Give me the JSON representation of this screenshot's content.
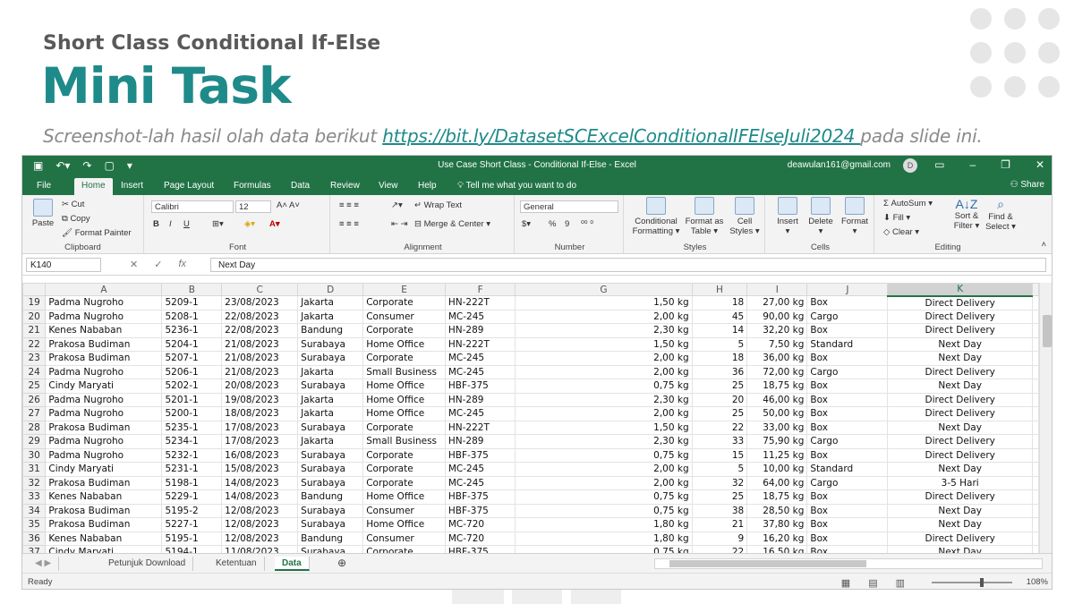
{
  "slide": {
    "kicker": "Short Class Conditional If-Else",
    "title": "Mini Task",
    "subtitle_pre": "Screenshot-lah hasil olah data berikut ",
    "subtitle_link": "https://bit.ly/DatasetSCExcelConditionalIFElseJuli2024 ",
    "subtitle_post": "pada slide ini."
  },
  "window": {
    "title": "Use Case Short Class - Conditional If-Else  -  Excel",
    "user_email": "deawulan161@gmail.com",
    "avatar_initial": "D",
    "icons": [
      "save-icon",
      "undo-icon",
      "redo-icon",
      "new-file-icon",
      "minimize-icon",
      "maximize-icon",
      "close-icon"
    ]
  },
  "ribbon_tabs": [
    "File",
    "Home",
    "Insert",
    "Page Layout",
    "Formulas",
    "Data",
    "Review",
    "View",
    "Help"
  ],
  "active_tab": "Home",
  "tell_me": "Tell me what you want to do",
  "share": "Share",
  "ribbon": {
    "clipboard": {
      "paste": "Paste",
      "cut": "Cut",
      "copy": "Copy",
      "format_painter": "Format Painter",
      "label": "Clipboard"
    },
    "font": {
      "family": "Calibri",
      "size": "12",
      "bold": "B",
      "italic": "I",
      "underline": "U",
      "label": "Font"
    },
    "alignment": {
      "wrap": "Wrap Text",
      "merge": "Merge & Center",
      "label": "Alignment"
    },
    "number": {
      "format": "General",
      "percent": "%",
      "comma": "9",
      "label": "Number"
    },
    "styles": {
      "conditional": "Conditional",
      "conditional2": "Formatting",
      "format_as": "Format as",
      "format_as2": "Table",
      "cell": "Cell",
      "cell2": "Styles",
      "label": "Styles"
    },
    "cells": {
      "insert": "Insert",
      "delete": "Delete",
      "format": "Format",
      "label": "Cells"
    },
    "editing": {
      "autosum": "AutoSum",
      "fill": "Fill",
      "clear": "Clear",
      "sort": "Sort &",
      "sort2": "Filter",
      "find": "Find &",
      "find2": "Select",
      "label": "Editing"
    }
  },
  "formula_bar": {
    "name_box": "K140",
    "fx": "fx",
    "value": "Next Day"
  },
  "columns": [
    "A",
    "B",
    "C",
    "D",
    "E",
    "F",
    "G",
    "H",
    "I",
    "J",
    "K"
  ],
  "selected_column": "K",
  "rows": [
    {
      "n": "19",
      "a": "Padma Nugroho",
      "b": "5209-1",
      "c": "23/08/2023",
      "d": "Jakarta",
      "e": "Corporate",
      "f": "HN-222T",
      "g": "1,50 kg",
      "h": "18",
      "i": "27,00 kg",
      "j": "Box",
      "k": "Direct Delivery"
    },
    {
      "n": "20",
      "a": "Padma Nugroho",
      "b": "5208-1",
      "c": "22/08/2023",
      "d": "Jakarta",
      "e": "Consumer",
      "f": "MC-245",
      "g": "2,00 kg",
      "h": "45",
      "i": "90,00 kg",
      "j": "Cargo",
      "k": "Direct Delivery"
    },
    {
      "n": "21",
      "a": "Kenes Nababan",
      "b": "5236-1",
      "c": "22/08/2023",
      "d": "Bandung",
      "e": "Corporate",
      "f": "HN-289",
      "g": "2,30 kg",
      "h": "14",
      "i": "32,20 kg",
      "j": "Box",
      "k": "Direct Delivery"
    },
    {
      "n": "22",
      "a": "Prakosa Budiman",
      "b": "5204-1",
      "c": "21/08/2023",
      "d": "Surabaya",
      "e": "Home Office",
      "f": "HN-222T",
      "g": "1,50 kg",
      "h": "5",
      "i": "7,50 kg",
      "j": "Standard",
      "k": "Next Day"
    },
    {
      "n": "23",
      "a": "Prakosa Budiman",
      "b": "5207-1",
      "c": "21/08/2023",
      "d": "Surabaya",
      "e": "Corporate",
      "f": "MC-245",
      "g": "2,00 kg",
      "h": "18",
      "i": "36,00 kg",
      "j": "Box",
      "k": "Next Day"
    },
    {
      "n": "24",
      "a": "Padma Nugroho",
      "b": "5206-1",
      "c": "21/08/2023",
      "d": "Jakarta",
      "e": "Small Business",
      "f": "MC-245",
      "g": "2,00 kg",
      "h": "36",
      "i": "72,00 kg",
      "j": "Cargo",
      "k": "Direct Delivery"
    },
    {
      "n": "25",
      "a": "Cindy Maryati",
      "b": "5202-1",
      "c": "20/08/2023",
      "d": "Surabaya",
      "e": "Home Office",
      "f": "HBF-375",
      "g": "0,75 kg",
      "h": "25",
      "i": "18,75 kg",
      "j": "Box",
      "k": "Next Day"
    },
    {
      "n": "26",
      "a": "Padma Nugroho",
      "b": "5201-1",
      "c": "19/08/2023",
      "d": "Jakarta",
      "e": "Home Office",
      "f": "HN-289",
      "g": "2,30 kg",
      "h": "20",
      "i": "46,00 kg",
      "j": "Box",
      "k": "Direct Delivery"
    },
    {
      "n": "27",
      "a": "Padma Nugroho",
      "b": "5200-1",
      "c": "18/08/2023",
      "d": "Jakarta",
      "e": "Home Office",
      "f": "MC-245",
      "g": "2,00 kg",
      "h": "25",
      "i": "50,00 kg",
      "j": "Box",
      "k": "Direct Delivery"
    },
    {
      "n": "28",
      "a": "Prakosa Budiman",
      "b": "5235-1",
      "c": "17/08/2023",
      "d": "Surabaya",
      "e": "Corporate",
      "f": "HN-222T",
      "g": "1,50 kg",
      "h": "22",
      "i": "33,00 kg",
      "j": "Box",
      "k": "Next Day"
    },
    {
      "n": "29",
      "a": "Padma Nugroho",
      "b": "5234-1",
      "c": "17/08/2023",
      "d": "Jakarta",
      "e": "Small Business",
      "f": "HN-289",
      "g": "2,30 kg",
      "h": "33",
      "i": "75,90 kg",
      "j": "Cargo",
      "k": "Direct Delivery"
    },
    {
      "n": "30",
      "a": "Padma Nugroho",
      "b": "5232-1",
      "c": "16/08/2023",
      "d": "Surabaya",
      "e": "Corporate",
      "f": "HBF-375",
      "g": "0,75 kg",
      "h": "15",
      "i": "11,25 kg",
      "j": "Box",
      "k": "Direct Delivery"
    },
    {
      "n": "31",
      "a": "Cindy Maryati",
      "b": "5231-1",
      "c": "15/08/2023",
      "d": "Surabaya",
      "e": "Corporate",
      "f": "MC-245",
      "g": "2,00 kg",
      "h": "5",
      "i": "10,00 kg",
      "j": "Standard",
      "k": "Next Day"
    },
    {
      "n": "32",
      "a": "Prakosa Budiman",
      "b": "5198-1",
      "c": "14/08/2023",
      "d": "Surabaya",
      "e": "Corporate",
      "f": "MC-245",
      "g": "2,00 kg",
      "h": "32",
      "i": "64,00 kg",
      "j": "Cargo",
      "k": "3-5 Hari"
    },
    {
      "n": "33",
      "a": "Kenes Nababan",
      "b": "5229-1",
      "c": "14/08/2023",
      "d": "Bandung",
      "e": "Home Office",
      "f": "HBF-375",
      "g": "0,75 kg",
      "h": "25",
      "i": "18,75 kg",
      "j": "Box",
      "k": "Direct Delivery"
    },
    {
      "n": "34",
      "a": "Prakosa Budiman",
      "b": "5195-2",
      "c": "12/08/2023",
      "d": "Surabaya",
      "e": "Consumer",
      "f": "HBF-375",
      "g": "0,75 kg",
      "h": "38",
      "i": "28,50 kg",
      "j": "Box",
      "k": "Next Day"
    },
    {
      "n": "35",
      "a": "Prakosa Budiman",
      "b": "5227-1",
      "c": "12/08/2023",
      "d": "Surabaya",
      "e": "Home Office",
      "f": "MC-720",
      "g": "1,80 kg",
      "h": "21",
      "i": "37,80 kg",
      "j": "Box",
      "k": "Next Day"
    },
    {
      "n": "36",
      "a": "Kenes Nababan",
      "b": "5195-1",
      "c": "12/08/2023",
      "d": "Bandung",
      "e": "Consumer",
      "f": "MC-720",
      "g": "1,80 kg",
      "h": "9",
      "i": "16,20 kg",
      "j": "Box",
      "k": "Direct Delivery"
    },
    {
      "n": "37",
      "a": "Cindy Maryati",
      "b": "5194-1",
      "c": "11/08/2023",
      "d": "Surabaya",
      "e": "Corporate",
      "f": "HBF-375",
      "g": "0,75 kg",
      "h": "22",
      "i": "16,50 kg",
      "j": "Box",
      "k": "Next Day"
    }
  ],
  "sheet_tabs": [
    "Petunjuk Download",
    "Ketentuan",
    "Data"
  ],
  "active_sheet": "Data",
  "add_sheet": "⊕",
  "status": {
    "text": "Ready",
    "zoom": "108%",
    "zoom_level_percent": 108
  },
  "colors": {
    "excel_green": "#217346",
    "title_teal": "#1f8a8a",
    "link": "#1f8a8a"
  }
}
